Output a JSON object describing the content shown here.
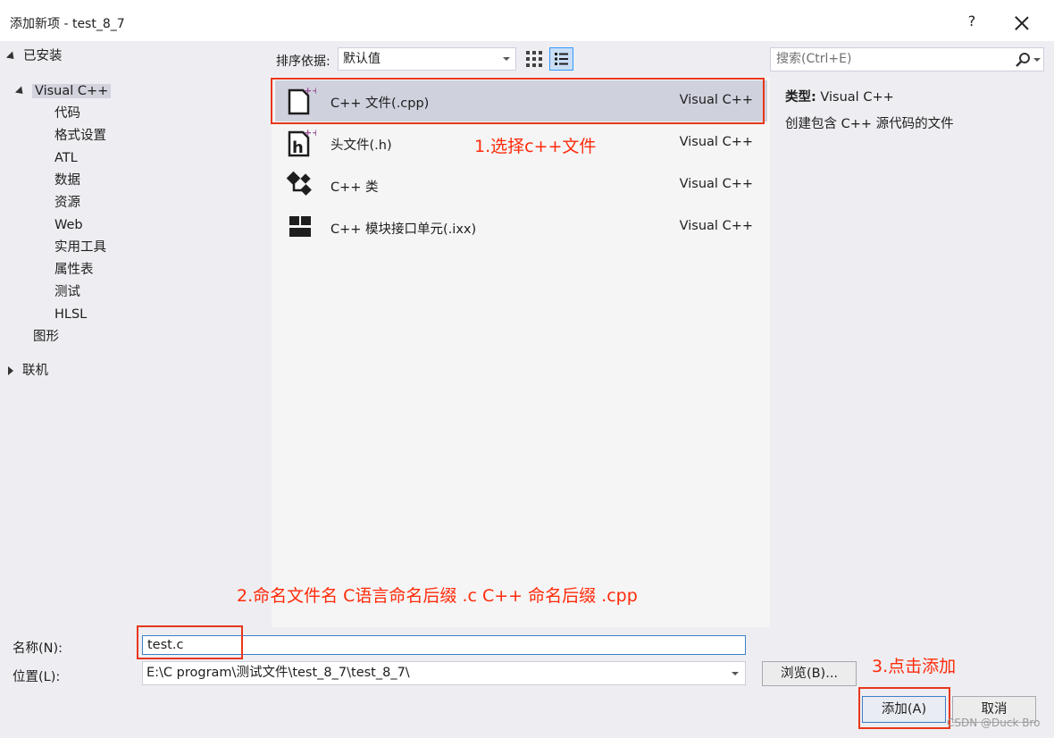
{
  "window": {
    "title": "添加新项 - test_8_7",
    "help_label": "?"
  },
  "tree": {
    "installed": "已安装",
    "visual_cpp": "Visual C++",
    "children": [
      "代码",
      "格式设置",
      "ATL",
      "数据",
      "资源",
      "Web",
      "实用工具",
      "属性表",
      "测试",
      "HLSL"
    ],
    "graphics": "图形",
    "online": "联机"
  },
  "toolbar": {
    "sort_label": "排序依据:",
    "sort_value": "默认值"
  },
  "search": {
    "placeholder": "搜索(Ctrl+E)"
  },
  "items": [
    {
      "name": "C++ 文件(.cpp)",
      "lang": "Visual C++",
      "icon": "cpp-file-icon",
      "selected": true
    },
    {
      "name": "头文件(.h)",
      "lang": "Visual C++",
      "icon": "header-file-icon",
      "selected": false
    },
    {
      "name": "C++ 类",
      "lang": "Visual C++",
      "icon": "cpp-class-icon",
      "selected": false
    },
    {
      "name": "C++ 模块接口单元(.ixx)",
      "lang": "Visual C++",
      "icon": "module-icon",
      "selected": false
    }
  ],
  "details": {
    "type_label": "类型:",
    "type_value": "Visual C++",
    "description": "创建包含 C++ 源代码的文件"
  },
  "annotations": {
    "step1": "1.选择c++文件",
    "step2": "2.命名文件名 C语言命名后缀 .c  C++ 命名后缀 .cpp",
    "step3": "3.点击添加",
    "color": "#ff2a0a"
  },
  "form": {
    "name_label": "名称(N):",
    "name_value": "test.c",
    "location_label": "位置(L):",
    "location_value": "E:\\C   program\\测试文件\\test_8_7\\test_8_7\\",
    "browse_label": "浏览(B)...",
    "add_label": "添加(A)",
    "cancel_label": "取消"
  },
  "watermark": "CSDN @Duck Bro"
}
